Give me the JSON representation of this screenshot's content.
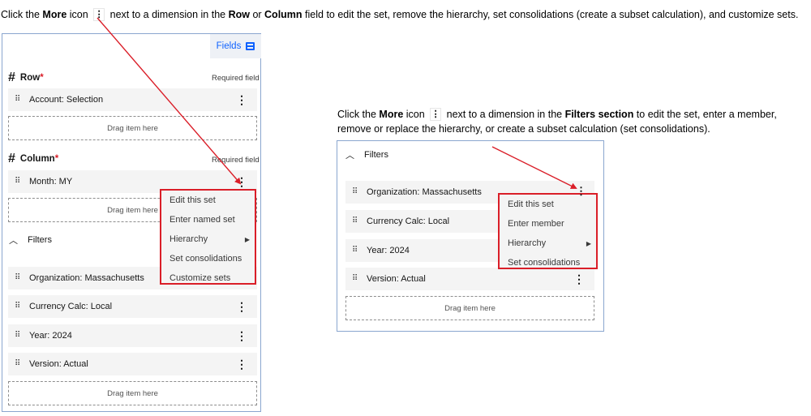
{
  "instructions": {
    "top": {
      "prefix": "Click the ",
      "more": "More",
      "icon_word": " icon ",
      "glyph": "⋮",
      "mid1": " next to a dimension in the ",
      "row": "Row",
      "or": " or ",
      "column": "Column",
      "suffix": " field to edit the set, remove the hierarchy, set consolidations (create a subset calculation), and customize sets."
    },
    "right": {
      "prefix": "Click the ",
      "more": "More",
      "icon_word": " icon ",
      "glyph": "⋮",
      "mid1": " next to a dimension in the ",
      "filters_section": "Filters section",
      "suffix1": " to edit the set, enter a member,",
      "line2": "remove or replace the hierarchy, or create a subset calculation (set consolidations)."
    }
  },
  "left_panel": {
    "fields_button": "Fields",
    "fields_icon": "panel-icon",
    "row": {
      "hash": "#",
      "title": "Row",
      "star": "*",
      "required": "Required field",
      "item": "Account: Selection",
      "drop": "Drag item here"
    },
    "column": {
      "hash": "#",
      "title": "Column",
      "star": "*",
      "required": "Required field",
      "item": "Month: MY",
      "drop": "Drag item here"
    },
    "filters": {
      "chevron": "^",
      "title": "Filters",
      "items": [
        "Organization: Massachusetts",
        "Currency Calc: Local",
        "Year: 2024",
        "Version: Actual"
      ],
      "drop": "Drag item here"
    },
    "menu": [
      "Edit this set",
      "Enter named set",
      "Hierarchy",
      "Set consolidations",
      "Customize sets"
    ]
  },
  "right_panel": {
    "filters": {
      "chevron": "^",
      "title": "Filters",
      "items": [
        "Organization: Massachusetts",
        "Currency Calc: Local",
        "Year: 2024",
        "Version: Actual"
      ],
      "drop": "Drag item here"
    },
    "menu": [
      "Edit this set",
      "Enter member",
      "Hierarchy",
      "Set consolidations"
    ]
  },
  "glyphs": {
    "drag": "⠿",
    "more": "⋮",
    "submenu_arrow": "▶"
  },
  "colors": {
    "accent": "#0f62fe",
    "highlight": "#da1e28",
    "panel_border": "#8aa6cf"
  }
}
